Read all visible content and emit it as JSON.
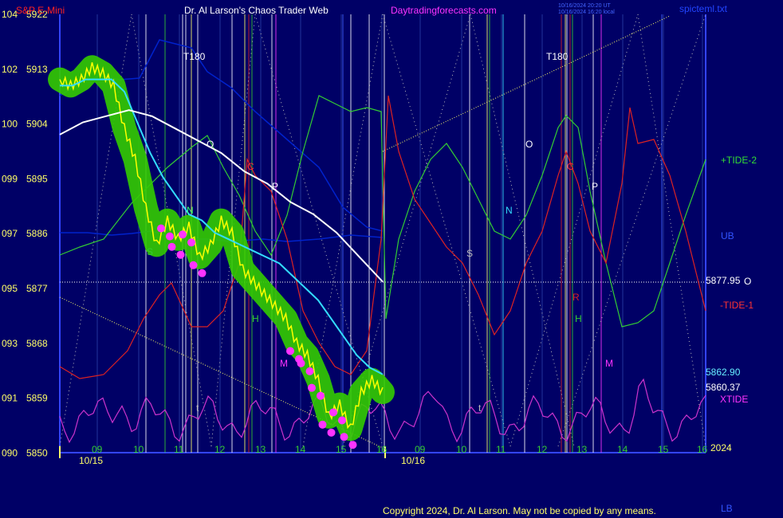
{
  "header": {
    "symbol": "S&P E-Mini",
    "title": "Dr. Al Larson's Chaos Trader Web",
    "site": "Daytradingforecasts.com",
    "stamp1": "10/16/2024 20:20 UT",
    "stamp2": "10/16/2024 16:20 local",
    "file": "spicteml.txt"
  },
  "left_axis": [
    {
      "a": "104",
      "b": "5922"
    },
    {
      "a": "102",
      "b": "5913"
    },
    {
      "a": "100",
      "b": "5904"
    },
    {
      "a": "099",
      "b": "5895"
    },
    {
      "a": "097",
      "b": "5886"
    },
    {
      "a": "095",
      "b": "5877"
    },
    {
      "a": "093",
      "b": "5868"
    },
    {
      "a": "091",
      "b": "5859"
    },
    {
      "a": "090",
      "b": "5850"
    }
  ],
  "hour_labels": [
    "09",
    "10",
    "11",
    "12",
    "13",
    "14",
    "15",
    "16",
    "09",
    "10",
    "11",
    "12",
    "13",
    "14",
    "15",
    "16"
  ],
  "day_labels": [
    "10/15",
    "10/16"
  ],
  "year_label": "2024",
  "right_labels": {
    "tide2": "+TIDE-2",
    "ub": "UB",
    "close_val": "5877.95",
    "close_code": "O",
    "tide1": "-TIDE-1",
    "cyan_val": "5862.90",
    "yellow_val": "5860.37",
    "xtide": "XTIDE",
    "lb": "LB"
  },
  "markers": [
    "T180",
    "T180",
    "O",
    "O",
    "C",
    "C",
    "P",
    "P",
    "N",
    "N",
    "S",
    "S",
    "H",
    "H",
    "M",
    "M",
    "R",
    "t",
    "t"
  ],
  "copyright": "Copyright 2024, Dr. Al Larson. May not be copied by any means.",
  "colors": {
    "background": "#000066",
    "grid": "#3344ff",
    "price": "#ffff00",
    "band": "#33cc00",
    "dots": "#ff33ff",
    "fast_ma": "#33ddff",
    "slow_ma": "#ffffff",
    "tide2": "#33cc33",
    "tide1": "#dd2222",
    "xtide": "#cc33cc",
    "bands_ub_lb": "#0022cc"
  },
  "chart_data": {
    "type": "line",
    "title": "S&P E-Mini",
    "y_range": [
      5850,
      5922
    ],
    "left_scale": [
      90,
      104
    ],
    "x_sessions": [
      "10/15",
      "10/16"
    ],
    "series": [
      {
        "name": "price",
        "values": [
          5911,
          5910,
          5911,
          5913,
          5912,
          5910,
          5903,
          5898,
          5890,
          5884,
          5888,
          5885,
          5887,
          5882,
          5884,
          5888,
          5886,
          5880,
          5878,
          5876,
          5874,
          5872,
          5868,
          5866,
          5862,
          5856,
          5858,
          5854,
          5860,
          5862,
          5860
        ]
      },
      {
        "name": "fast ma",
        "values": [
          5910,
          5910,
          5911,
          5911,
          5911,
          5909,
          5904,
          5899,
          5895,
          5892,
          5889,
          5888,
          5886,
          5885,
          5884,
          5883,
          5882,
          5881,
          5879,
          5877,
          5875,
          5872,
          5869,
          5866,
          5864,
          5862.9
        ]
      },
      {
        "name": "slow ma",
        "values": [
          5902,
          5904,
          5905,
          5906,
          5905,
          5903,
          5901,
          5899,
          5896,
          5894,
          5891,
          5889,
          5886,
          5882,
          5878
        ]
      }
    ],
    "annotations": {
      "close": 5877.95,
      "fast_ma_last": 5862.9,
      "price_last": 5860.37
    }
  }
}
